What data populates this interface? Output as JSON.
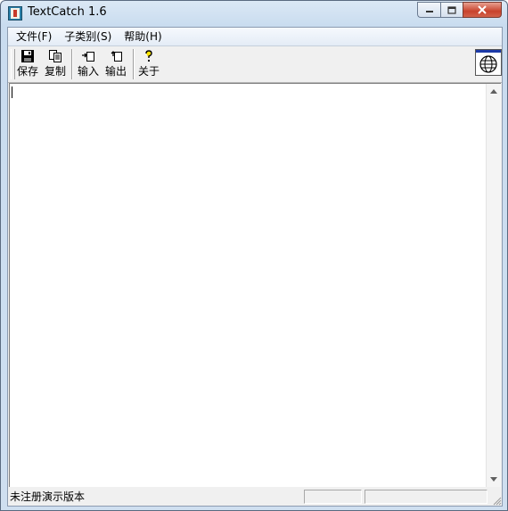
{
  "window": {
    "title": "TextCatch 1.6"
  },
  "menu": [
    {
      "label": "文件(F)"
    },
    {
      "label": "子类别(S)"
    },
    {
      "label": "帮助(H)"
    }
  ],
  "toolbar": {
    "save": "保存",
    "copy": "复制",
    "import": "输入",
    "export": "输出",
    "about": "关于"
  },
  "editor": {
    "content": ""
  },
  "status": {
    "text": "未注册演示版本",
    "panel1": "",
    "panel2": ""
  }
}
